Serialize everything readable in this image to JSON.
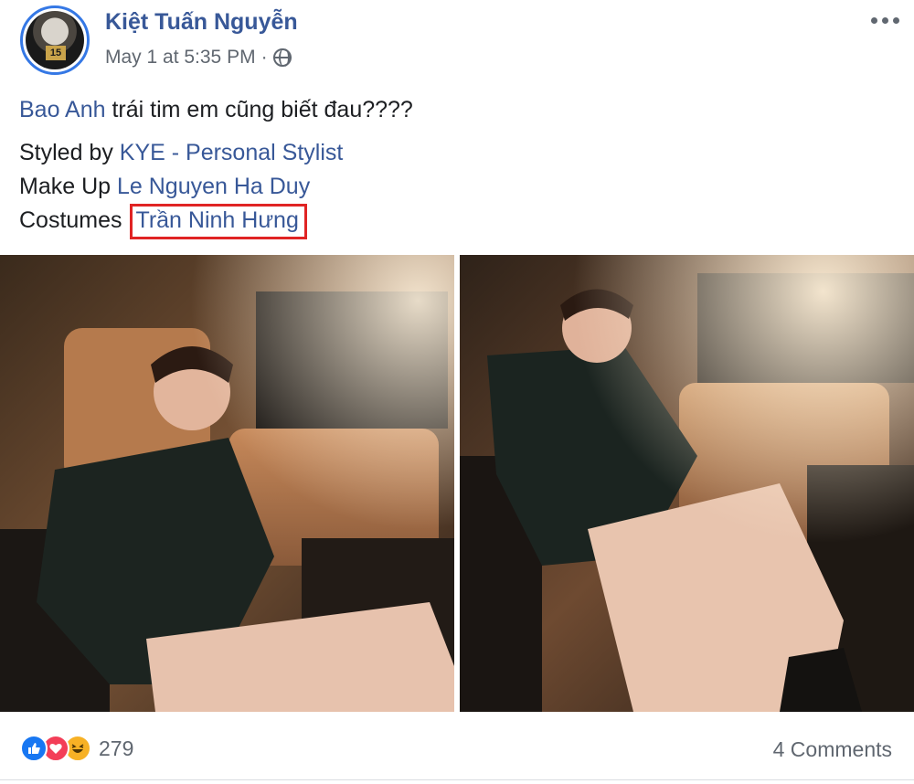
{
  "post": {
    "author": "Kiệt Tuấn Nguyễn",
    "timestamp": "May 1 at 5:35 PM",
    "separator": "·",
    "privacy_icon": "globe-icon",
    "more_icon": "more-options-icon",
    "avatar_badge": "15",
    "text": {
      "line1_tag": "Bao Anh",
      "line1_rest": " trái tim em cũng biết đau????",
      "line2_prefix": "Styled by ",
      "line2_tag": "KYE - Personal Stylist",
      "line3_prefix": "Make Up ",
      "line3_tag": "Le Nguyen Ha Duy",
      "line4_prefix": "Costumes ",
      "line4_tag": "Trần Ninh Hưng"
    },
    "photos": [
      "photo-left",
      "photo-right"
    ]
  },
  "footer": {
    "reaction_icons": [
      "like-icon",
      "love-icon",
      "haha-icon"
    ],
    "reaction_count": "279",
    "comments": "4 Comments"
  },
  "colors": {
    "link": "#385898",
    "highlight_border": "#e02424",
    "meta": "#606770"
  }
}
